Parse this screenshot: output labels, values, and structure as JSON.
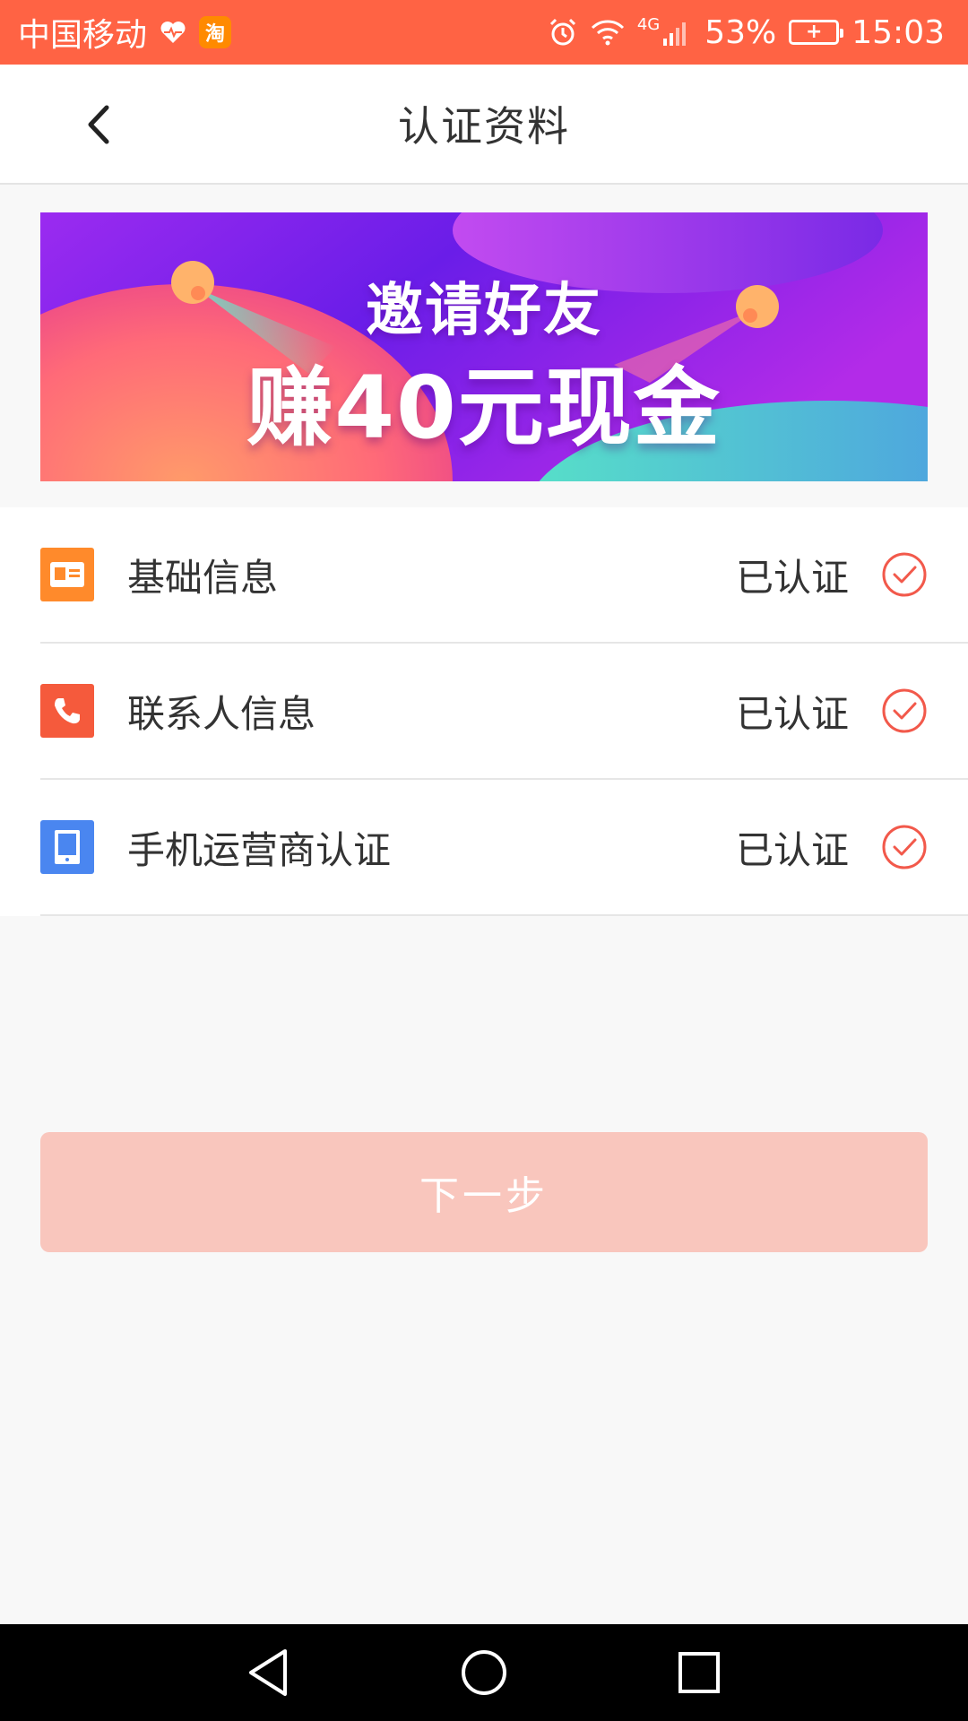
{
  "status_bar": {
    "carrier": "中国移动",
    "app_badge": "淘",
    "network": "4G",
    "battery_percent": "53%",
    "time": "15:03"
  },
  "header": {
    "title": "认证资料"
  },
  "banner": {
    "line1": "邀请好友",
    "line2": "赚40元现金"
  },
  "items": [
    {
      "label": "基础信息",
      "status": "已认证",
      "icon": "id-card-icon",
      "color": "#ff8a2b"
    },
    {
      "label": "联系人信息",
      "status": "已认证",
      "icon": "phone-icon",
      "color": "#f55a3c"
    },
    {
      "label": "手机运营商认证",
      "status": "已认证",
      "icon": "mobile-device-icon",
      "color": "#4a86f0"
    }
  ],
  "next_button": {
    "label": "下一步"
  },
  "colors": {
    "accent": "#ff6344",
    "check": "#f2594b",
    "button_disabled": "#f9c6bd"
  }
}
